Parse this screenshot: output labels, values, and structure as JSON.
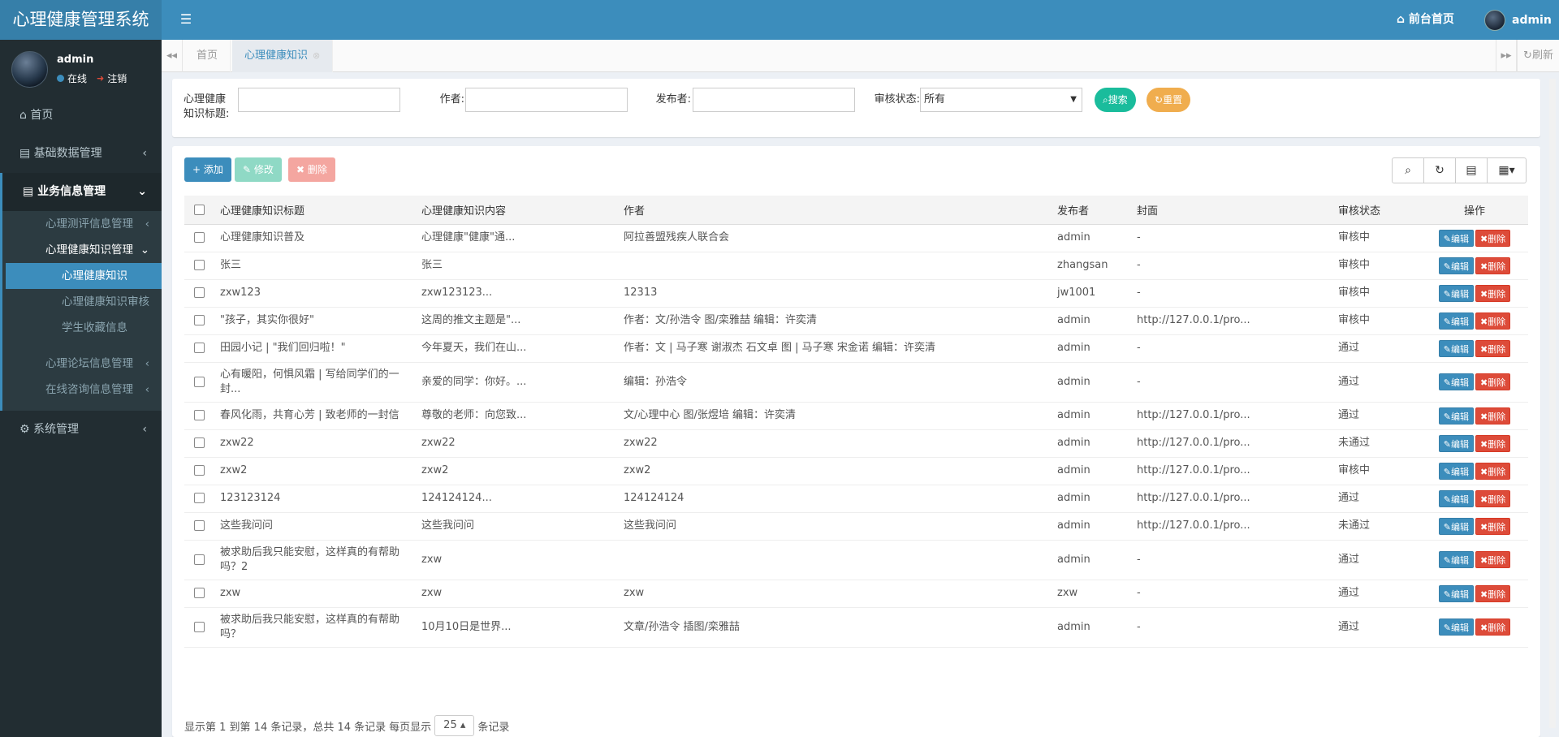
{
  "app": {
    "title": "心理健康管理系统"
  },
  "topbar": {
    "front_link": "前台首页",
    "username": "admin",
    "menu_icon": "bars-icon",
    "home_icon": "home-icon"
  },
  "user_panel": {
    "name": "admin",
    "status": "在线",
    "logout": "注销"
  },
  "sidebar": {
    "items": [
      {
        "label": "首页",
        "icon": "home-icon"
      },
      {
        "label": "基础数据管理",
        "icon": "list-icon"
      },
      {
        "label": "业务信息管理",
        "icon": "list-icon"
      },
      {
        "label": "系统管理",
        "icon": "gear-icon"
      }
    ],
    "sub_items": [
      "心理测评信息管理",
      "心理健康知识管理",
      "心理论坛信息管理",
      "在线咨询信息管理"
    ],
    "subsub_items": [
      "心理健康知识",
      "心理健康知识审核",
      "学生收藏信息"
    ]
  },
  "tabs": {
    "items": [
      "首页",
      "心理健康知识"
    ],
    "refresh": "刷新"
  },
  "filter": {
    "title_label": "心理健康知识标题:",
    "author_label": "作者:",
    "publisher_label": "发布者:",
    "status_label": "审核状态:",
    "status_value": "所有",
    "search_btn": "搜索",
    "reset_btn": "重置"
  },
  "actions": {
    "add": "添加",
    "edit": "修改",
    "delete": "删除"
  },
  "table": {
    "headers": [
      "心理健康知识标题",
      "心理健康知识内容",
      "作者",
      "发布者",
      "封面",
      "审核状态",
      "操作"
    ],
    "edit_label": "编辑",
    "delete_label": "删除",
    "rows": [
      {
        "title": "心理健康知识普及",
        "content": "心理健康\"健康\"通...",
        "author": "阿拉善盟残疾人联合会",
        "publisher": "admin",
        "cover": "-",
        "status": "审核中"
      },
      {
        "title": "张三",
        "content": "张三",
        "author": "",
        "publisher": "zhangsan",
        "cover": "-",
        "status": "审核中"
      },
      {
        "title": "zxw123",
        "content": "zxw123123...",
        "author": "12313",
        "publisher": "jw1001",
        "cover": "-",
        "status": "审核中"
      },
      {
        "title": "\"孩子，其实你很好\"",
        "content": "这周的推文主题是\"...",
        "author": "作者：文/孙浩令 图/栾雅喆 编辑：许奕清",
        "publisher": "admin",
        "cover": "http://127.0.0.1/pro...",
        "status": "审核中"
      },
      {
        "title": "田园小记 | \"我们回归啦！\"",
        "content": "今年夏天，我们在山...",
        "author": "作者：文 | 马子寒 谢淑杰 石文卓 图 | 马子寒 宋金诺 编辑：许奕清",
        "publisher": "admin",
        "cover": "-",
        "status": "通过"
      },
      {
        "title": "心有暖阳，何惧风霜 | 写给同学们的一封...",
        "content": "亲爱的同学：你好。...",
        "author": "编辑：孙浩令",
        "publisher": "admin",
        "cover": "-",
        "status": "通过"
      },
      {
        "title": "春风化雨，共育心芳 | 致老师的一封信",
        "content": "尊敬的老师：向您致...",
        "author": "文/心理中心 图/张煜培 编辑：许奕清",
        "publisher": "admin",
        "cover": "http://127.0.0.1/pro...",
        "status": "通过"
      },
      {
        "title": "zxw22",
        "content": "zxw22",
        "author": "zxw22",
        "publisher": "admin",
        "cover": "http://127.0.0.1/pro...",
        "status": "未通过"
      },
      {
        "title": "zxw2",
        "content": "zxw2",
        "author": "zxw2",
        "publisher": "admin",
        "cover": "http://127.0.0.1/pro...",
        "status": "审核中"
      },
      {
        "title": "123123124",
        "content": "124124124...",
        "author": "124124124",
        "publisher": "admin",
        "cover": "http://127.0.0.1/pro...",
        "status": "通过"
      },
      {
        "title": "这些我问问",
        "content": "这些我问问",
        "author": "这些我问问",
        "publisher": "admin",
        "cover": "http://127.0.0.1/pro...",
        "status": "未通过"
      },
      {
        "title": "被求助后我只能安慰，这样真的有帮助吗？2",
        "content": "zxw",
        "author": "",
        "publisher": "admin",
        "cover": "-",
        "status": "通过"
      },
      {
        "title": "zxw",
        "content": "zxw",
        "author": "zxw",
        "publisher": "zxw",
        "cover": "-",
        "status": "通过"
      },
      {
        "title": "被求助后我只能安慰，这样真的有帮助吗？",
        "content": "10月10日是世界...",
        "author": "文章/孙浩令 插图/栾雅喆",
        "publisher": "admin",
        "cover": "-",
        "status": "通过"
      }
    ]
  },
  "pager": {
    "summary": "显示第 1 到第 14 条记录，总共 14 条记录",
    "per_page_label": "每页显示",
    "page_size": "25",
    "suffix": "条记录"
  },
  "colors": {
    "header": "#3c8dbc",
    "logo": "#367fa9",
    "sidebar": "#222d32",
    "add": "#3c8dbc",
    "edit": "#8fd9c5",
    "delete": "#f4a6a0",
    "search": "#00a65a",
    "reset": "#f39c12"
  }
}
